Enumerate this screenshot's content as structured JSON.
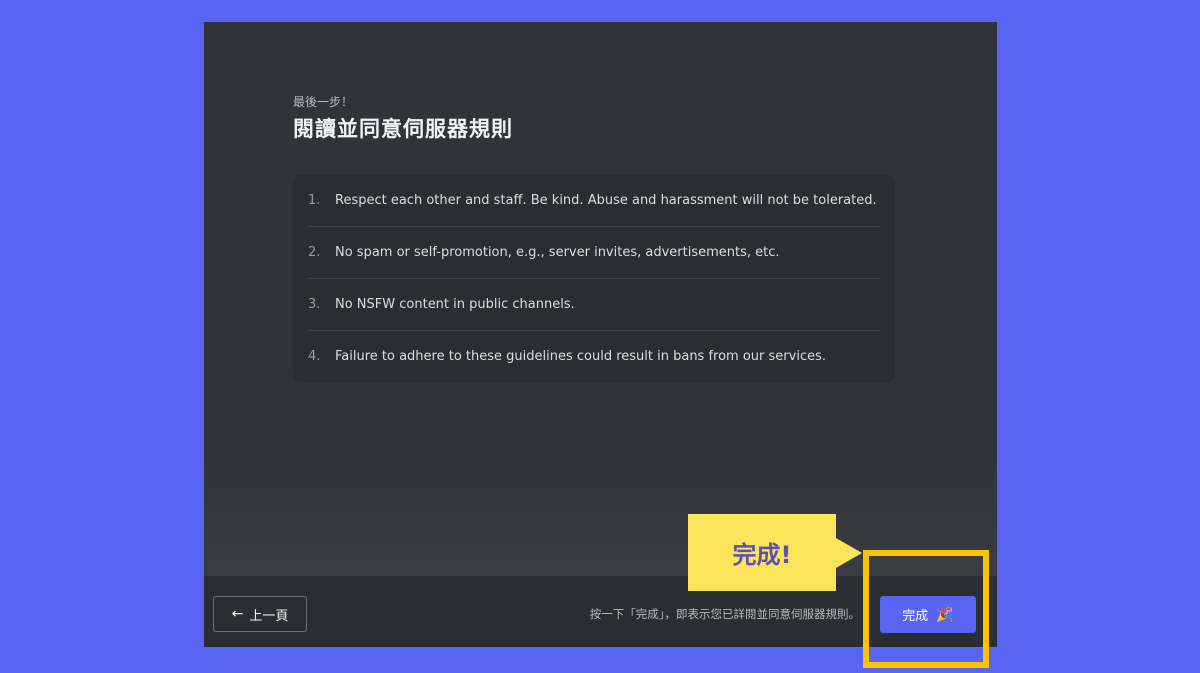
{
  "header": {
    "step_label": "最後一步！",
    "title": "閱讀並同意伺服器規則"
  },
  "rules": [
    {
      "num": "1.",
      "text": "Respect each other and staff. Be kind. Abuse and harassment will not be tolerated."
    },
    {
      "num": "2.",
      "text": "No spam or self-promotion, e.g., server invites, advertisements, etc."
    },
    {
      "num": "3.",
      "text": "No NSFW content in public channels."
    },
    {
      "num": "4.",
      "text": "Failure to adhere to these guidelines could result in bans from our services."
    }
  ],
  "footer": {
    "back_label": "上一頁",
    "back_icon": "arrow-left-icon",
    "hint": "按一下「完成」，即表示您已詳閱並同意伺服器規則。",
    "finish_label": "完成",
    "finish_icon": "party-popper-icon"
  },
  "callout": {
    "text": "完成!"
  },
  "colors": {
    "background": "#5865f2",
    "modal": "#313338",
    "accent": "#5865f2",
    "callout": "#fbe35a",
    "highlight": "#fbc300"
  }
}
